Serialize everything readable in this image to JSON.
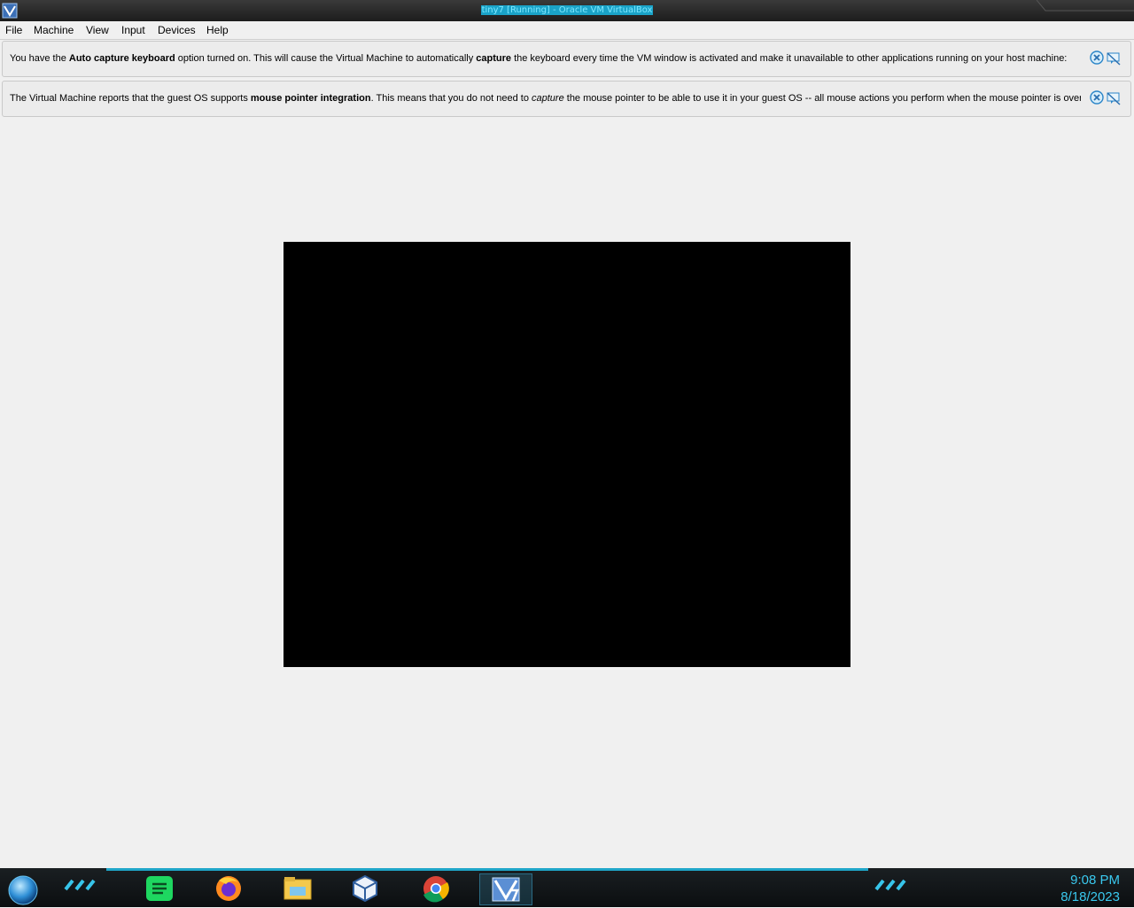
{
  "window": {
    "title": "tiny7 [Running] - Oracle VM VirtualBox"
  },
  "menu": {
    "items": [
      "File",
      "Machine",
      "View",
      "Input",
      "Devices",
      "Help"
    ]
  },
  "notices": [
    {
      "parts": [
        {
          "t": "You have the ",
          "s": "n"
        },
        {
          "t": "Auto capture keyboard",
          "s": "b"
        },
        {
          "t": " option turned on. This will cause the Virtual Machine to automatically ",
          "s": "n"
        },
        {
          "t": "capture",
          "s": "b"
        },
        {
          "t": " the keyboard every time the VM window is activated and make it unavailable to other applications running on your host machine:",
          "s": "n"
        }
      ]
    },
    {
      "parts": [
        {
          "t": "The Virtual Machine reports that the guest OS supports ",
          "s": "n"
        },
        {
          "t": "mouse pointer integration",
          "s": "b"
        },
        {
          "t": ". This means that you do not need to ",
          "s": "n"
        },
        {
          "t": "capture",
          "s": "i"
        },
        {
          "t": " the mouse pointer to be able to use it in your guest OS -- all mouse actions you perform when the mouse pointer is over",
          "s": "n"
        }
      ]
    }
  ],
  "taskbar": {
    "apps": [
      "spotify-icon",
      "firefox-icon",
      "file-explorer-icon",
      "virtualbox-icon",
      "chrome-icon",
      "virtualbox-vm-icon"
    ]
  },
  "clock": {
    "time": "9:08 PM",
    "date": "8/18/2023"
  },
  "colors": {
    "accent": "#1fa6c9",
    "clock": "#3ac9ef"
  }
}
